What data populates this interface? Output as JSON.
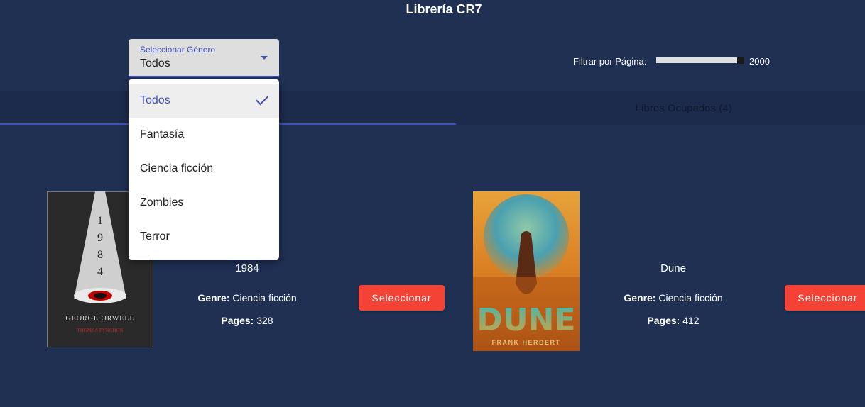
{
  "app_title": "Librería CR7",
  "genre_select": {
    "label": "Seleccionar Género",
    "value": "Todos",
    "options": [
      "Todos",
      "Fantasía",
      "Ciencia ficción",
      "Zombies",
      "Terror"
    ],
    "selected_index": 0
  },
  "page_filter": {
    "label": "Filtrar por Página:",
    "value": "2000",
    "fill_fraction": 1.0
  },
  "tabs": [
    {
      "label": ""
    },
    {
      "label": "Libros Ocupados (4)"
    }
  ],
  "books": [
    {
      "title": "1984",
      "genre_label": "Genre:",
      "genre": "Ciencia ficción",
      "pages_label": "Pages:",
      "pages": "328",
      "button": "Seleccionar",
      "cover": {
        "digits": [
          "1",
          "9",
          "8",
          "4"
        ],
        "author": "GEORGE ORWELL",
        "subtitle": "THOMAS PYNCHON"
      }
    },
    {
      "title": "Dune",
      "genre_label": "Genre:",
      "genre": "Ciencia ficción",
      "pages_label": "Pages:",
      "pages": "412",
      "button": "Seleccionar",
      "cover": {
        "title": "DUNE",
        "author": "FRANK HERBERT"
      }
    }
  ],
  "colors": {
    "background": "#1f3053",
    "accent": "#3f51b5",
    "button": "#f44336"
  }
}
